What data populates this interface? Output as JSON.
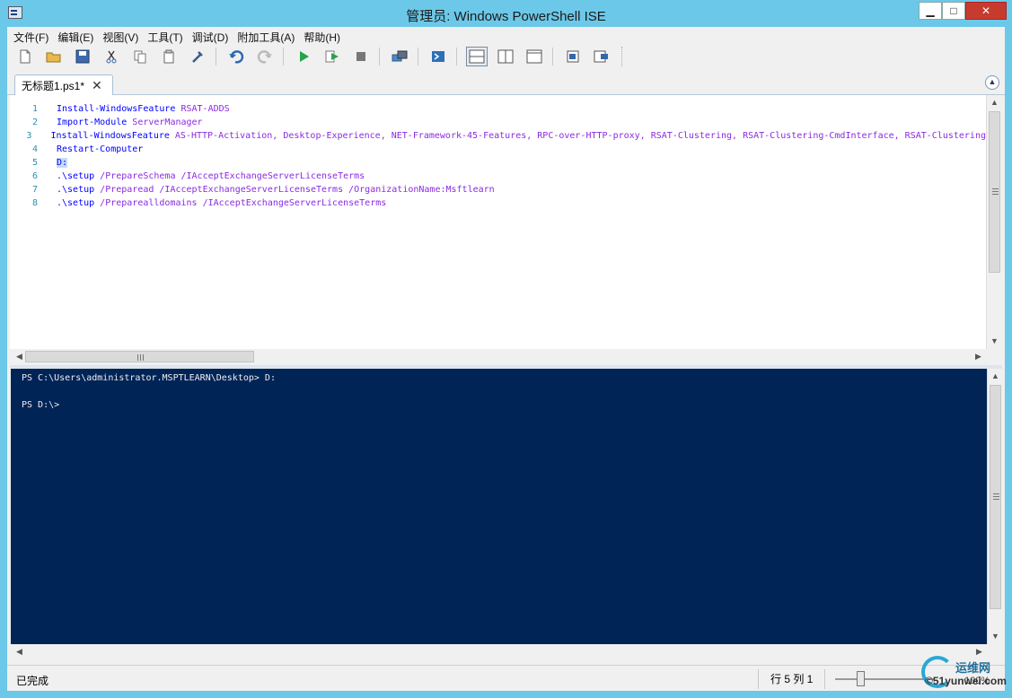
{
  "window": {
    "title": "管理员: Windows PowerShell ISE",
    "controls": {
      "minimize": "▁",
      "maximize": "□",
      "close": "✕"
    }
  },
  "menu": [
    "文件(F)",
    "编辑(E)",
    "视图(V)",
    "工具(T)",
    "调试(D)",
    "附加工具(A)",
    "帮助(H)"
  ],
  "toolbar": {
    "icons": [
      "new-file-icon",
      "open-folder-icon",
      "save-icon",
      "cut-icon",
      "copy-icon",
      "paste-icon",
      "clear-icon",
      "undo-icon",
      "redo-icon",
      "run-script-icon",
      "run-selection-icon",
      "stop-icon",
      "remote-powershell-icon",
      "powershell-console-icon",
      "layout-top-icon",
      "layout-right-icon",
      "layout-maximize-icon",
      "show-command-icon",
      "show-command-addon-icon"
    ]
  },
  "tab": {
    "label": "无标题1.ps1*",
    "close": "✕"
  },
  "editor": {
    "lines": [
      {
        "num": "1",
        "cmd": "Install-WindowsFeature",
        "args": " RSAT-ADDS"
      },
      {
        "num": "2",
        "cmd": "Import-Module",
        "args": " ServerManager"
      },
      {
        "num": "3",
        "cmd": "Install-WindowsFeature",
        "args": " AS-HTTP-Activation, Desktop-Experience, NET-Framework-45-Features, RPC-over-HTTP-proxy, RSAT-Clustering, RSAT-Clustering-CmdInterface, RSAT-Clustering"
      },
      {
        "num": "4",
        "cmd": "Restart-Computer",
        "args": ""
      },
      {
        "num": "5",
        "cmd": "D:",
        "args": ""
      },
      {
        "num": "6",
        "cmd": ".\\setup",
        "args": " /PrepareSchema /IAcceptExchangeServerLicenseTerms"
      },
      {
        "num": "7",
        "cmd": ".\\setup",
        "args": " /Preparead /IAcceptExchangeServerLicenseTerms /OrganizationName:Msftlearn"
      },
      {
        "num": "8",
        "cmd": ".\\setup",
        "args": " /Preparealldomains /IAcceptExchangeServerLicenseTerms"
      }
    ]
  },
  "console": {
    "lines": [
      "PS C:\\Users\\administrator.MSPTLEARN\\Desktop> D:",
      "",
      "PS D:\\>"
    ]
  },
  "status": {
    "text": "已完成",
    "position": "行 5  列 1",
    "zoom": "100%"
  },
  "watermark": {
    "brand": "运维网",
    "sub": "©51yunwei.com"
  },
  "colors": {
    "console_bg": "#012456",
    "title_bg": "#6cc8e8",
    "cmd": "#0000ff",
    "arg": "#8a2be2",
    "line_num": "#2b91af"
  }
}
